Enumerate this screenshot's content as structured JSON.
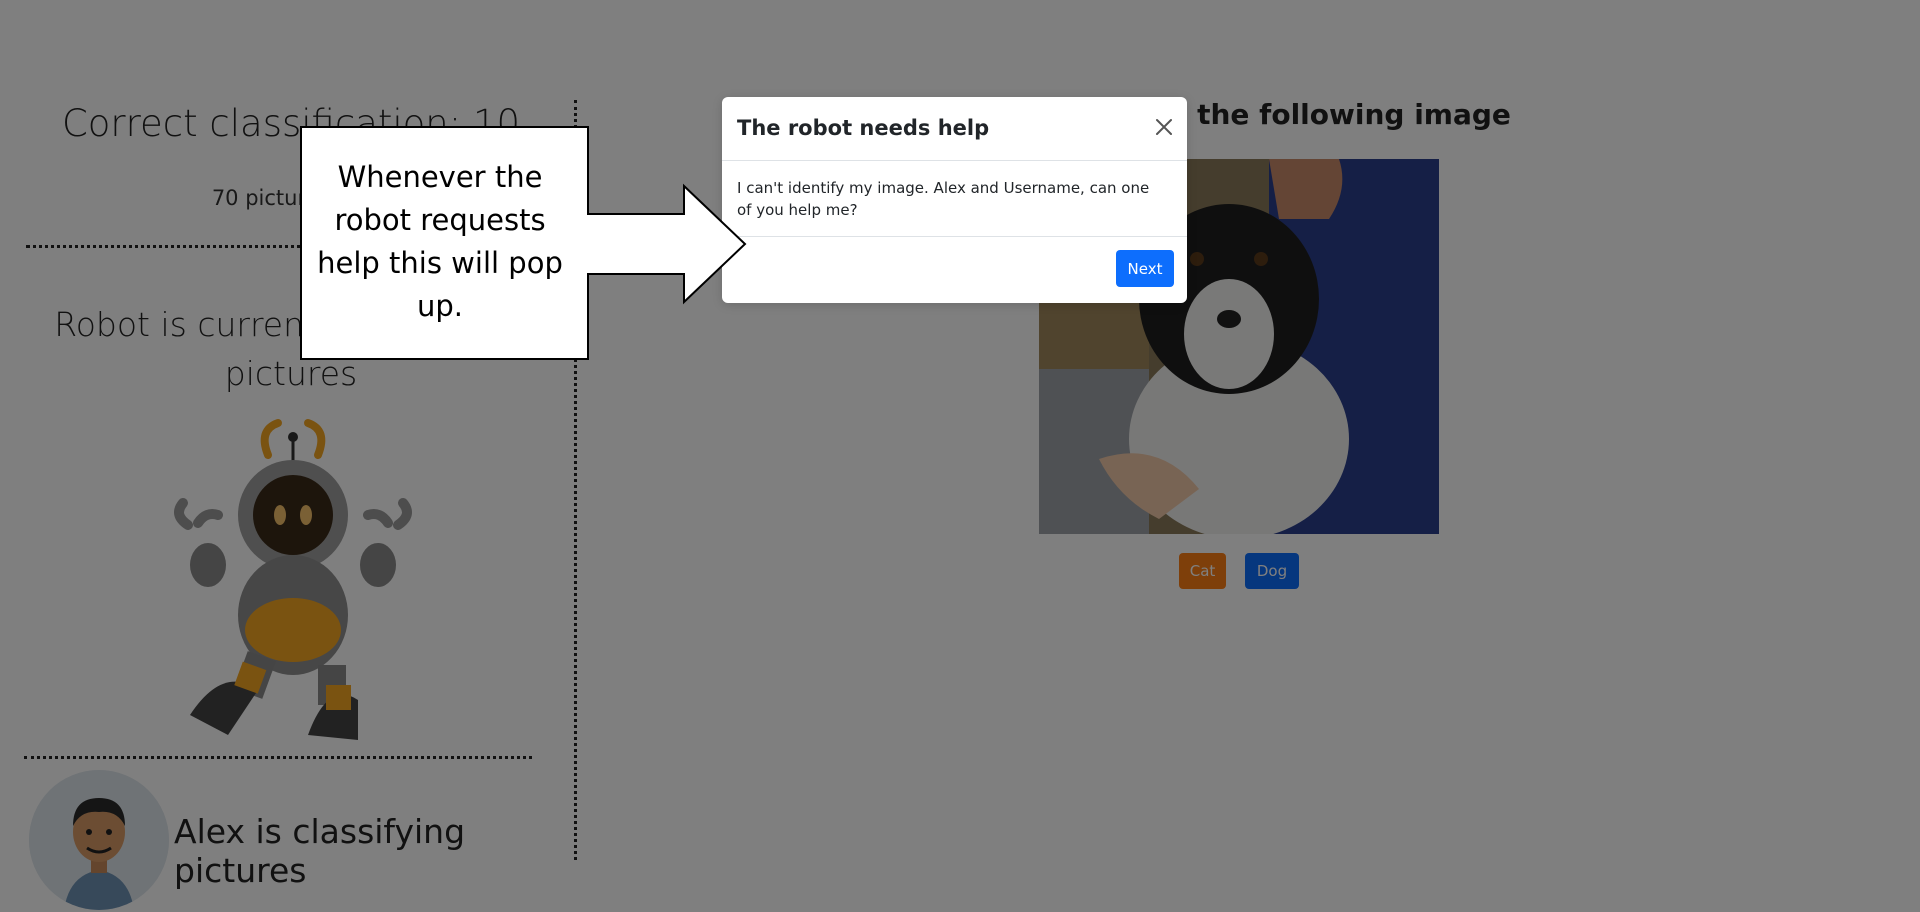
{
  "left_panel": {
    "score_title": "Correct classification: 10",
    "pictures_left": "70 pictures left",
    "robot_status": "Robot is currently classifying pictures",
    "alex_status": "Alex is classifying pictures"
  },
  "right_panel": {
    "instruction": "y the following image",
    "buttons": {
      "cat": "Cat",
      "dog": "Dog"
    }
  },
  "modal": {
    "title": "The robot needs help",
    "body": "I can't identify my image. Alex and Username, can one of you help me?",
    "next_label": "Next"
  },
  "callout": {
    "text": "Whenever the robot requests help this will pop up."
  },
  "colors": {
    "primary": "#0d6efd",
    "cat_button": "#fd7e14",
    "backdrop": "rgba(0,0,0,0.5)",
    "robot_accent": "#f5a623"
  },
  "icons": [
    "close-icon",
    "robot-illustration",
    "avatar-illustration",
    "dog-photo"
  ]
}
